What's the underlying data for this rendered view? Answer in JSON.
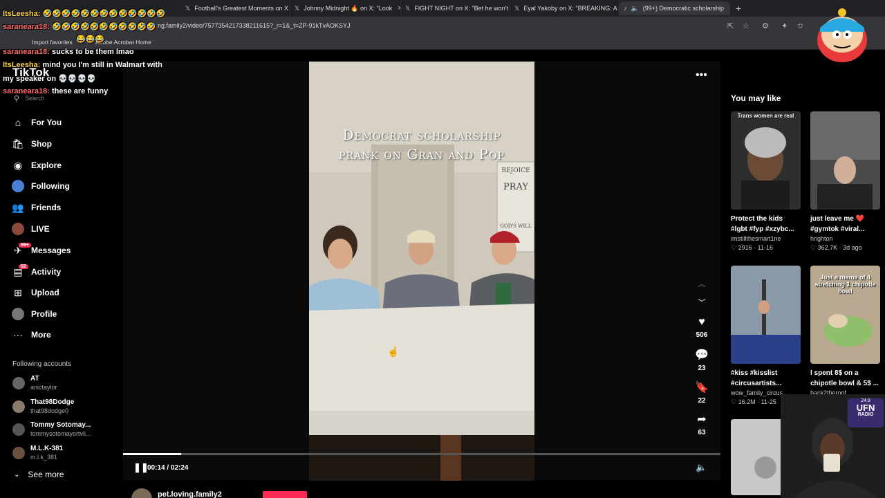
{
  "browser": {
    "tabs": [
      {
        "label": "Football's Greatest Moments on X"
      },
      {
        "label": "Johnny Midnight 🔥 on X: \"Look"
      },
      {
        "label": "FIGHT NIGHT on X: \"Bet he won't"
      },
      {
        "label": "Eyal Yakoby on X: \"BREAKING: A p"
      },
      {
        "label": "(99+) Democratic scholarship"
      }
    ],
    "url": "ng.family2/video/7577354217338211615?_r=1&_t=ZP-91kTvAOKSYJ",
    "bookmarks": [
      "Import favorites",
      "Adobe Acrobat Home"
    ]
  },
  "chat": [
    {
      "user": "ItsLeesha:",
      "text": "🤣🤣🤣🤣🤣🤣🤣🤣🤣🤣🤣🤣🤣"
    },
    {
      "user": "saraneara18:",
      "text": "🤣🤣🤣🤣🤣🤣🤣🤣🤣🤣🤣"
    },
    {
      "user": "",
      "text": "😂😂😂"
    },
    {
      "user": "saraneara18:",
      "text": "sucks to be them lmao"
    },
    {
      "user": "ItsLeesha:",
      "text": "mind you I'm still in Walmart with"
    },
    {
      "user": "",
      "text": "my speaker on 💀💀💀💀"
    },
    {
      "user": "saraneara18:",
      "text": "these are funny"
    }
  ],
  "tiktok": {
    "logo": "TikTok",
    "search_placeholder": "Search",
    "nav": [
      {
        "label": "For You",
        "icon": "home-icon"
      },
      {
        "label": "Shop",
        "icon": "shop-icon"
      },
      {
        "label": "Explore",
        "icon": "compass-icon"
      },
      {
        "label": "Following",
        "icon": "following-icon"
      },
      {
        "label": "Friends",
        "icon": "friends-icon"
      },
      {
        "label": "LIVE",
        "icon": "live-icon"
      },
      {
        "label": "Messages",
        "icon": "messages-icon",
        "badge": "99+"
      },
      {
        "label": "Activity",
        "icon": "activity-icon",
        "badge": "52"
      },
      {
        "label": "Upload",
        "icon": "upload-icon"
      },
      {
        "label": "Profile",
        "icon": "profile-icon"
      },
      {
        "label": "More",
        "icon": "more-icon"
      }
    ],
    "following_title": "Following accounts",
    "accounts": [
      {
        "name": "AT",
        "handle": "anictaylor"
      },
      {
        "name": "That98Dodge",
        "handle": "that98dodge0"
      },
      {
        "name": "Tommy Sotomay...",
        "handle": "tommysotomayortvli..."
      },
      {
        "name": "M.L.K-381",
        "handle": "m.l.k_381"
      }
    ],
    "see_more": "See more"
  },
  "video": {
    "title_line1": "Democrat scholarship",
    "title_line2": "prank on Gran and Pop",
    "current_time": "00:14",
    "total_time": "02:24",
    "time_display": "00:14 / 02:24",
    "progress_fraction": 0.097,
    "author": "pet.loving.family2",
    "likes": "506",
    "comments": "23",
    "saves": "22",
    "shares": "63"
  },
  "sidebar": {
    "title": "You may like",
    "cards": [
      {
        "caption": "Protect the kids",
        "caption2": "#lgbt #fyp #xzybc...",
        "author": "imstillthesmart1ne",
        "stats": "♡ 2916 · 11-16",
        "overlay": "Trans women are real"
      },
      {
        "caption": "just leave me ❤️",
        "caption2": "#gymtok #viral...",
        "author": "hrighton",
        "stats": "♡ 362.7K · 3d ago",
        "overlay": ""
      },
      {
        "caption": "#kiss #kisslist",
        "caption2": "#circusartists...",
        "author": "wow_family_circus",
        "stats": "♡ 16.2M · 11-25",
        "overlay": ""
      },
      {
        "caption": "I spent 8$ on a",
        "caption2": "chipotle bowl & 5$ ...",
        "author": "back2theroof",
        "stats": "",
        "overlay": "Just a mama of 4 stretching 1 chipotle bowl"
      }
    ]
  },
  "stream_overlay": {
    "radio_line1": "24.9",
    "radio_line2": "UFN",
    "radio_line3": "RADIO"
  }
}
